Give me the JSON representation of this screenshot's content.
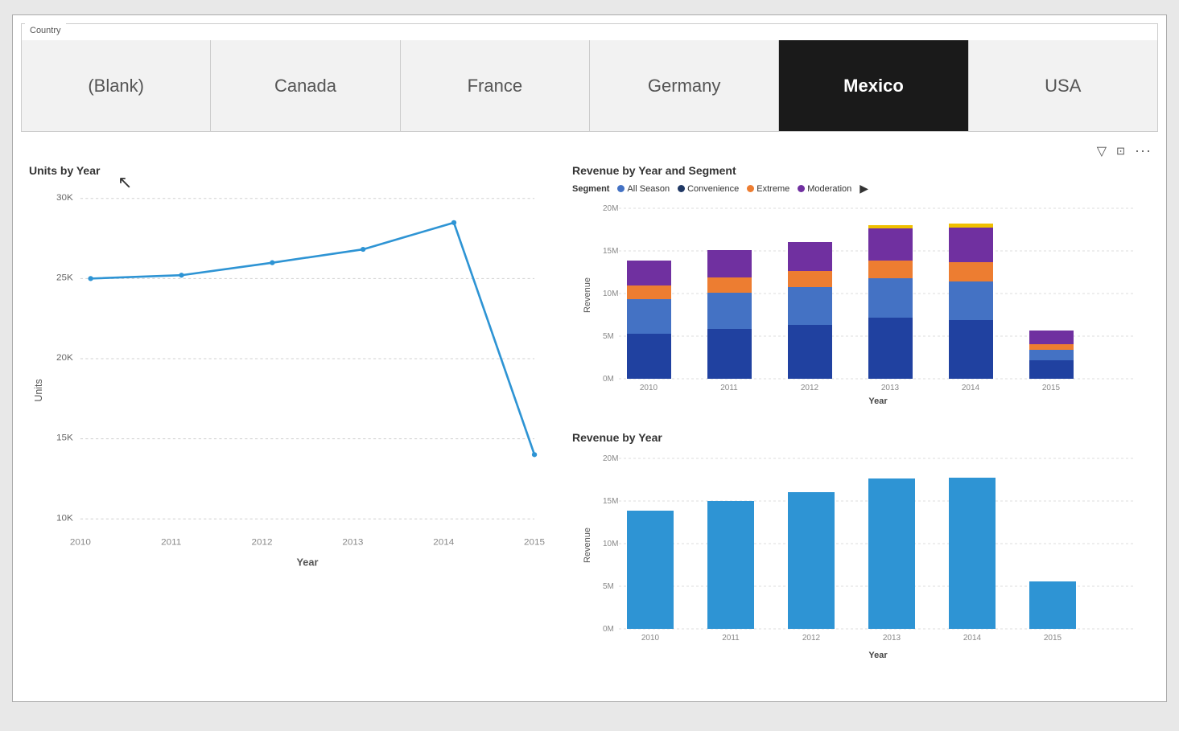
{
  "slicer": {
    "label": "Country",
    "buttons": [
      {
        "id": "blank",
        "label": "(Blank)",
        "active": false
      },
      {
        "id": "canada",
        "label": "Canada",
        "active": false
      },
      {
        "id": "france",
        "label": "France",
        "active": false
      },
      {
        "id": "germany",
        "label": "Germany",
        "active": false
      },
      {
        "id": "mexico",
        "label": "Mexico",
        "active": true
      },
      {
        "id": "usa",
        "label": "USA",
        "active": false
      }
    ]
  },
  "toolbar": {
    "filter_icon": "▽",
    "expand_icon": "⊡",
    "more_icon": "···"
  },
  "units_chart": {
    "title": "Units by Year",
    "y_axis_title": "Units",
    "x_axis_title": "Year",
    "y_labels": [
      "30K",
      "25K",
      "20K",
      "15K",
      "10K"
    ],
    "x_labels": [
      "2010",
      "2011",
      "2012",
      "2013",
      "2014",
      "2015"
    ],
    "data": [
      {
        "year": "2010",
        "value": 25000
      },
      {
        "year": "2011",
        "value": 25200
      },
      {
        "year": "2012",
        "value": 26000
      },
      {
        "year": "2013",
        "value": 26800
      },
      {
        "year": "2014",
        "value": 28500
      },
      {
        "year": "2015",
        "value": 14000
      }
    ]
  },
  "rev_segment_chart": {
    "title": "Revenue by Year and Segment",
    "y_axis_title": "Revenue",
    "x_axis_title": "Year",
    "y_labels": [
      "20M",
      "15M",
      "10M",
      "5M",
      "0M"
    ],
    "x_labels": [
      "2010",
      "2011",
      "2012",
      "2013",
      "2014",
      "2015"
    ],
    "legend": {
      "segment_label": "Segment",
      "items": [
        {
          "label": "All Season",
          "color": "#4472C4"
        },
        {
          "label": "Convenience",
          "color": "#203864"
        },
        {
          "label": "Extreme",
          "color": "#ED7D31"
        },
        {
          "label": "Moderation",
          "color": "#7030A0"
        }
      ]
    },
    "data": [
      {
        "year": "2010",
        "all_season": 3800,
        "convenience": 5000,
        "extreme": 1500,
        "moderation": 2800
      },
      {
        "year": "2011",
        "all_season": 4000,
        "convenience": 5500,
        "extreme": 1700,
        "moderation": 3000
      },
      {
        "year": "2012",
        "all_season": 4200,
        "convenience": 6000,
        "extreme": 1800,
        "moderation": 3200
      },
      {
        "year": "2013",
        "all_season": 4400,
        "convenience": 6800,
        "extreme": 2000,
        "moderation": 3500
      },
      {
        "year": "2014",
        "all_season": 4300,
        "convenience": 6500,
        "extreme": 2200,
        "moderation": 3800
      },
      {
        "year": "2015",
        "all_season": 1200,
        "convenience": 2000,
        "extreme": 600,
        "moderation": 1500
      }
    ]
  },
  "rev_year_chart": {
    "title": "Revenue by Year",
    "y_axis_title": "Revenue",
    "x_axis_title": "Year",
    "y_labels": [
      "20M",
      "15M",
      "10M",
      "5M",
      "0M"
    ],
    "x_labels": [
      "2010",
      "2011",
      "2012",
      "2013",
      "2014",
      "2015"
    ],
    "data": [
      {
        "year": "2010",
        "value": 13100
      },
      {
        "year": "2011",
        "value": 14200
      },
      {
        "year": "2012",
        "value": 15200
      },
      {
        "year": "2013",
        "value": 16700
      },
      {
        "year": "2014",
        "value": 16800
      },
      {
        "year": "2015",
        "value": 5300
      }
    ]
  }
}
